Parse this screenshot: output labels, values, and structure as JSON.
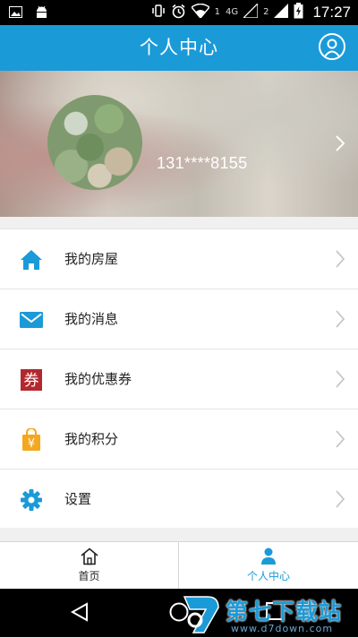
{
  "status_bar": {
    "time": "17:27",
    "sim1_network": "4G",
    "sim1_label": "1",
    "sim2_label": "2",
    "icons": [
      "image-icon",
      "android-icon",
      "vibrate-icon",
      "alarm-icon",
      "wifi-icon",
      "signal-icon",
      "battery-charging-icon"
    ]
  },
  "header": {
    "title": "个人中心",
    "profile_icon": "user-circle-icon",
    "background_color": "#1b9ad8"
  },
  "profile": {
    "phone": "131****8155"
  },
  "menu": [
    {
      "label": "我的房屋",
      "icon": "house-icon",
      "color": "#1b9ad8"
    },
    {
      "label": "我的消息",
      "icon": "envelope-icon",
      "color": "#1b9ad8"
    },
    {
      "label": "我的优惠券",
      "icon": "coupon-icon",
      "icon_text": "券",
      "color": "#b3282d"
    },
    {
      "label": "我的积分",
      "icon": "points-bag-icon",
      "icon_text": "¥",
      "color": "#f4a81d"
    },
    {
      "label": "设置",
      "icon": "gear-icon",
      "color": "#1b9ad8"
    }
  ],
  "tabbar": {
    "tabs": [
      {
        "label": "首页",
        "icon": "home-outline-icon",
        "active": false
      },
      {
        "label": "个人中心",
        "icon": "person-icon",
        "active": true
      }
    ],
    "active_color": "#1b9ad8",
    "inactive_color": "#222222"
  },
  "watermark": {
    "text": "第七下载站",
    "url": "www.d7down.com"
  }
}
